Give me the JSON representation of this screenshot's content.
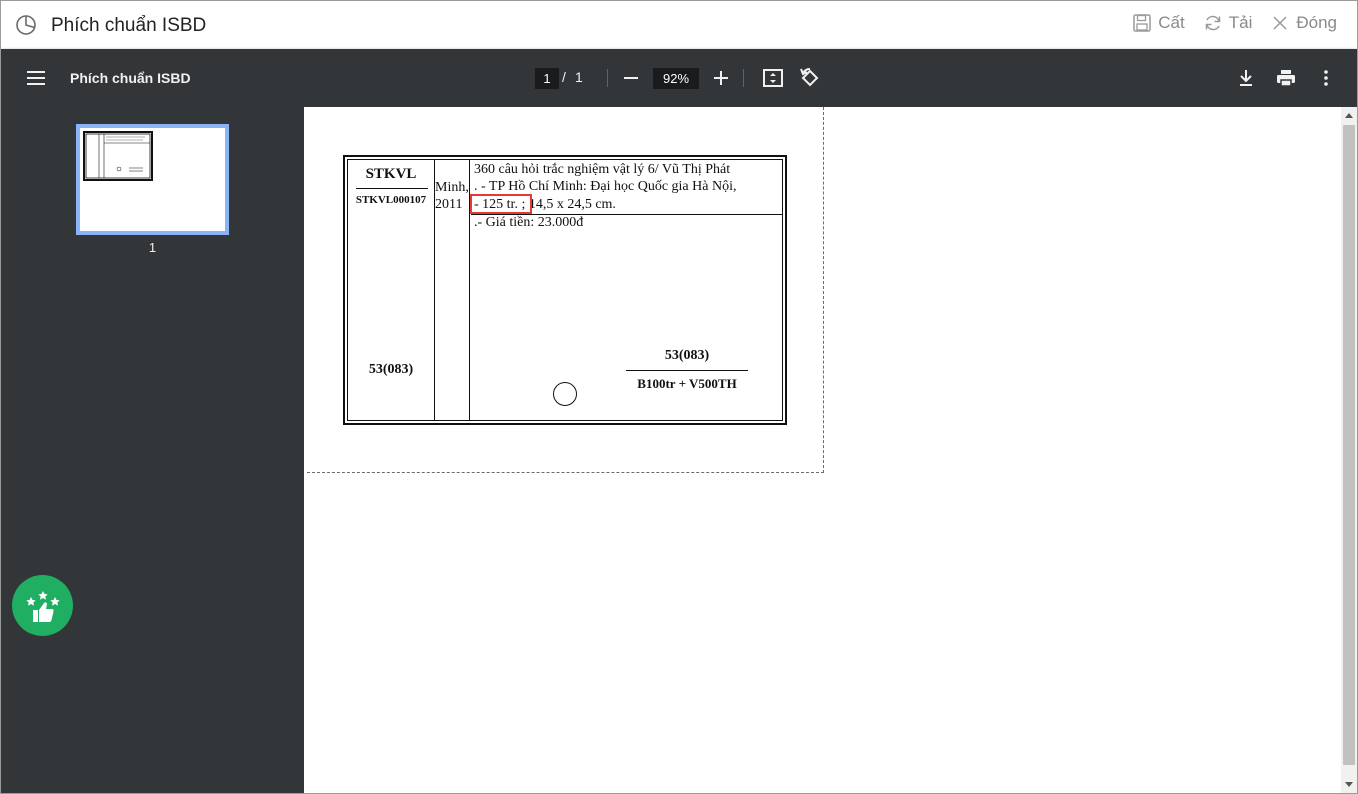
{
  "window": {
    "title": "Phích chuẩn ISBD",
    "actions": {
      "save_label": "Cất",
      "reload_label": "Tải",
      "close_label": "Đóng"
    }
  },
  "toolbar": {
    "doc_title": "Phích chuẩn ISBD",
    "page_current": "1",
    "page_separator": "/",
    "page_total": "1",
    "zoom": "92%"
  },
  "sidebar": {
    "thumbnails": [
      {
        "label": "1"
      }
    ]
  },
  "card": {
    "call_number_top": "STKVL",
    "call_number_id": "STKVL000107",
    "classification_left": "53(083)",
    "middle_column": [
      "Minh,",
      "2011"
    ],
    "description_lines": [
      "360 câu hỏi trắc nghiệm vật lý 6/ Vũ Thị Phát",
      ". - TP Hồ Chí Minh: Đại học Quốc gia Hà Nội,",
      "- 125 tr. ; 14,5 x 24,5 cm.",
      ".- Giá tiền: 23.000đ"
    ],
    "classification_right_top": "53(083)",
    "classification_right_bottom": "B100tr + V500TH"
  },
  "colors": {
    "toolbar_bg": "#323639",
    "thumbnail_selected": "#8ab4f8",
    "rating_fab": "#1fae62",
    "highlight": "#e53935"
  }
}
